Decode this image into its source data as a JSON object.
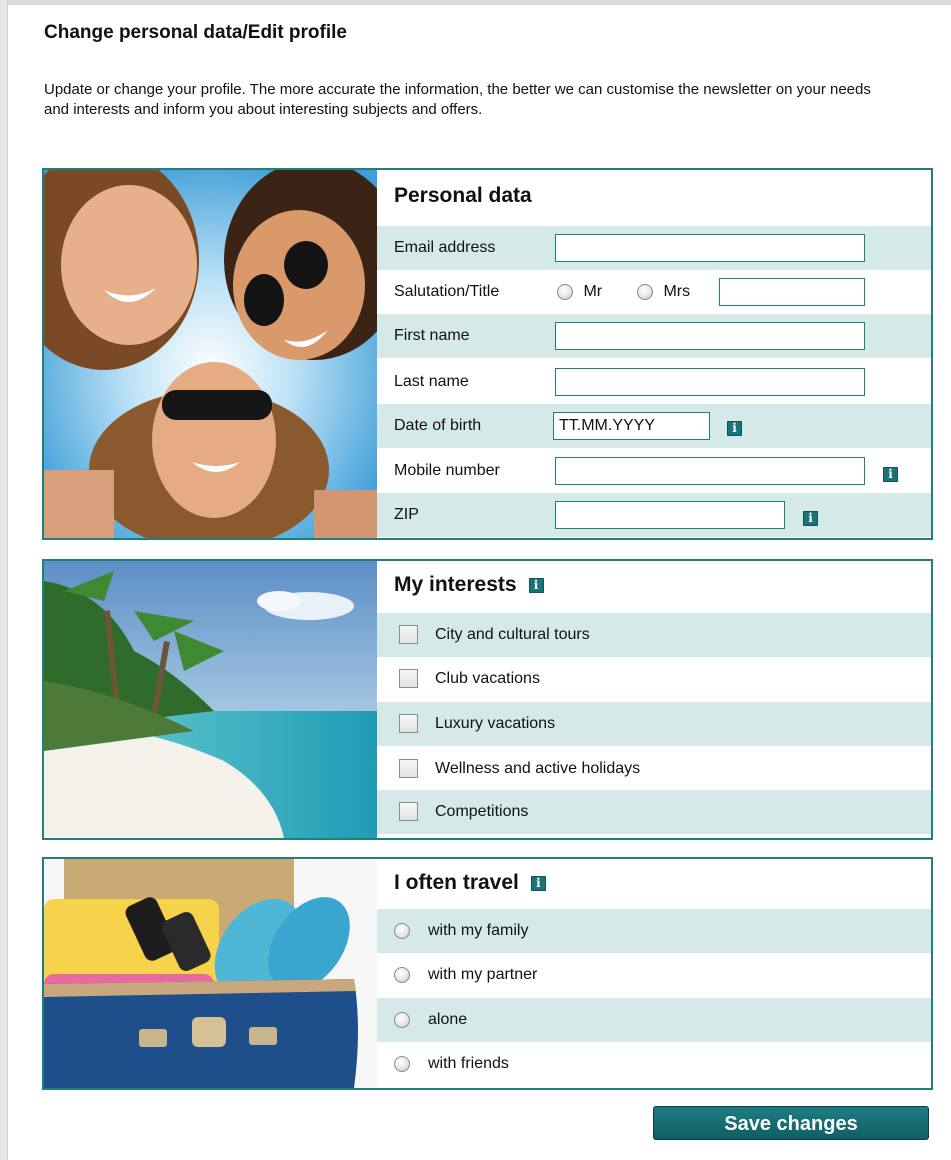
{
  "page": {
    "title": "Change personal data/Edit profile",
    "intro": "Update or change your profile. The more accurate the information, the better we can customise the newsletter on your needs and interests and inform you about interesting subjects and offers."
  },
  "personal": {
    "heading": "Personal data",
    "fields": {
      "email": {
        "label": "Email address",
        "value": ""
      },
      "salutation": {
        "label": "Salutation/Title",
        "option_mr": "Mr",
        "option_mrs": "Mrs",
        "title_value": ""
      },
      "first_name": {
        "label": "First name",
        "value": ""
      },
      "last_name": {
        "label": "Last name",
        "value": ""
      },
      "dob": {
        "label": "Date of birth",
        "value": "TT.MM.YYYY"
      },
      "mobile": {
        "label": "Mobile number",
        "value": ""
      },
      "zip": {
        "label": "ZIP",
        "value": ""
      }
    }
  },
  "interests": {
    "heading": "My interests",
    "items": [
      "City and cultural tours",
      "Club vacations",
      "Luxury vacations",
      "Wellness and active holidays",
      "Competitions"
    ]
  },
  "travel": {
    "heading": "I often travel",
    "options": [
      "with my family",
      "with my partner",
      "alone",
      "with friends"
    ]
  },
  "actions": {
    "save_label": "Save changes"
  },
  "icons": {
    "info": "info-icon",
    "info_glyph": "i"
  },
  "colors": {
    "accent": "#1f7f7c",
    "row_shade": "#d5e9e9",
    "button": "#157076"
  }
}
